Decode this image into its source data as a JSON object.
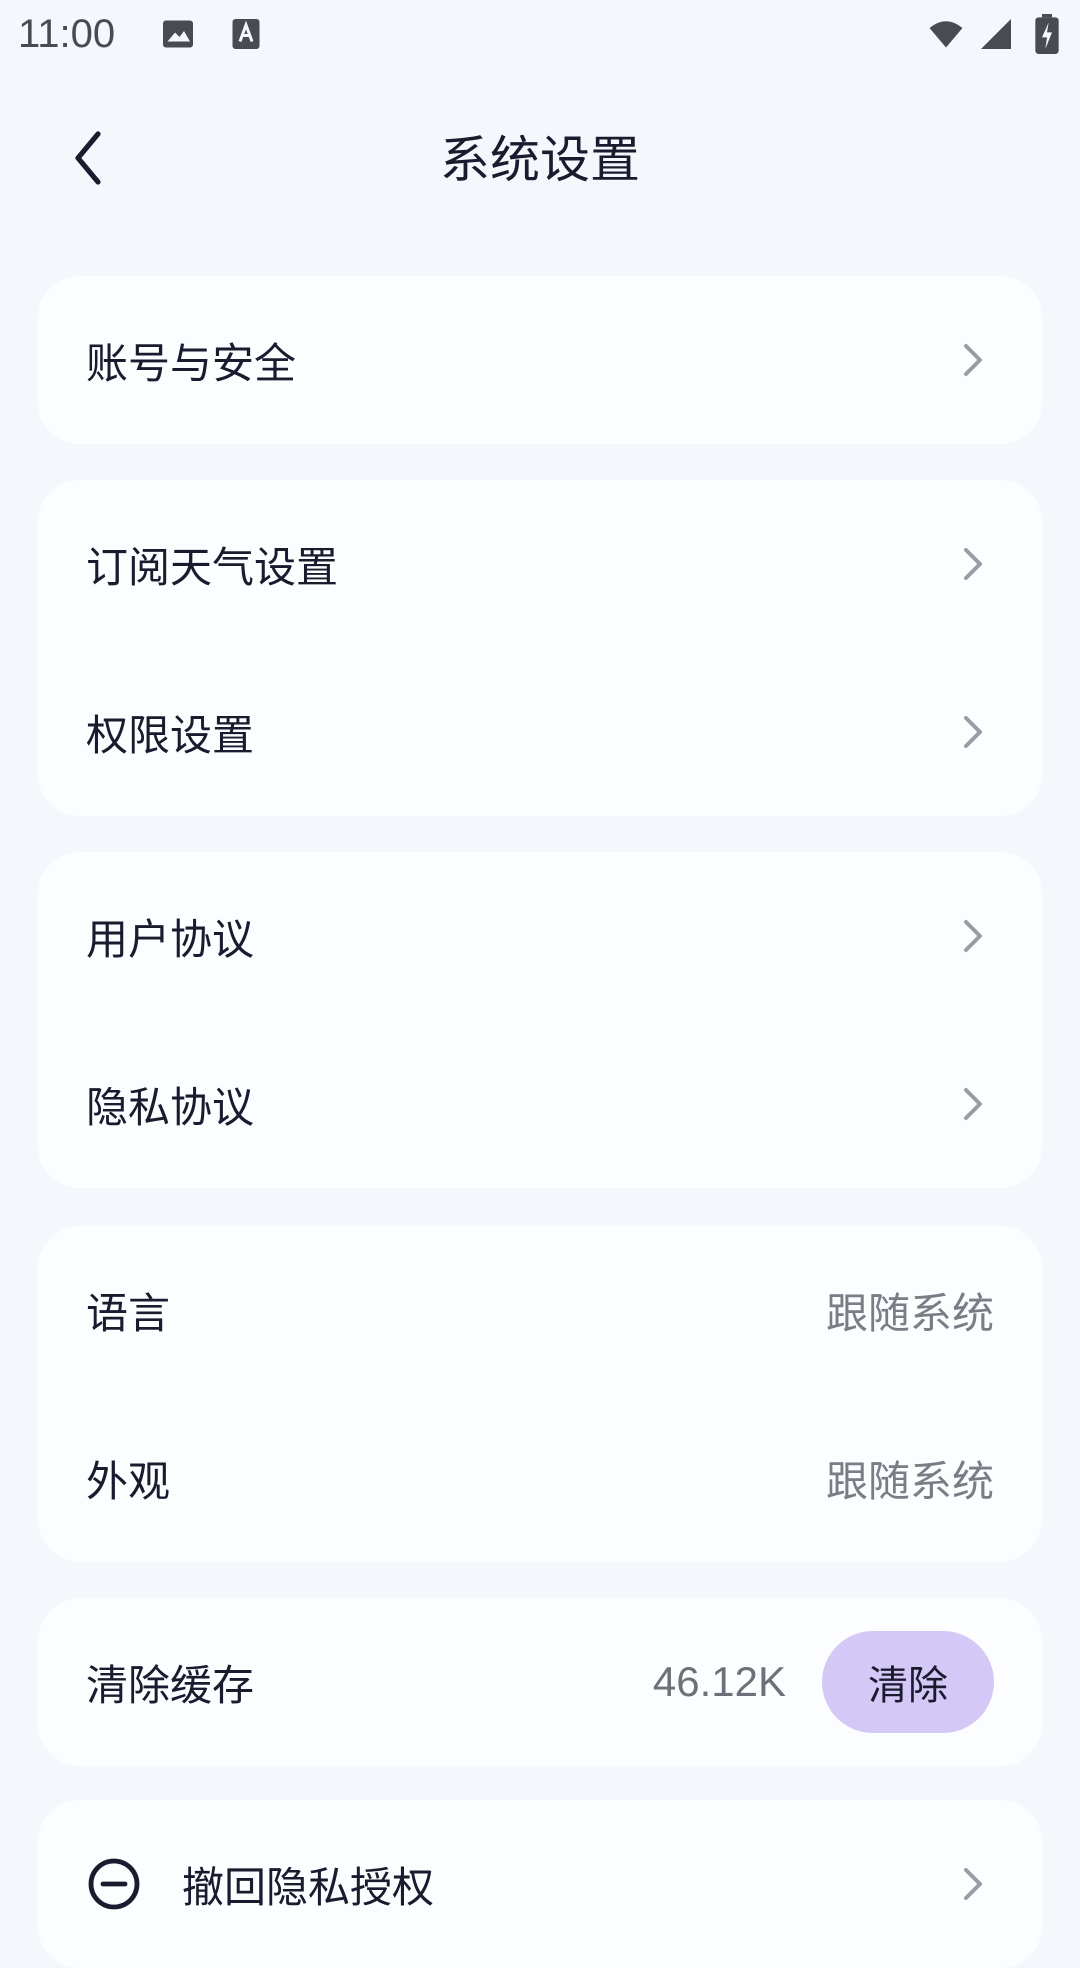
{
  "status_bar": {
    "time": "11:00",
    "icons": [
      "image-icon",
      "font-a-icon",
      "wifi-icon",
      "signal-icon",
      "battery-charging-icon"
    ]
  },
  "header": {
    "title": "系统设置",
    "back_icon": "chevron-left-icon"
  },
  "settings": {
    "account_security": "账号与安全",
    "weather_subscription": "订阅天气设置",
    "permissions": "权限设置",
    "user_agreement": "用户协议",
    "privacy_agreement": "隐私协议",
    "language": {
      "label": "语言",
      "value": "跟随系统"
    },
    "appearance": {
      "label": "外观",
      "value": "跟随系统"
    },
    "clear_cache": {
      "label": "清除缓存",
      "size": "46.12K",
      "button": "清除"
    },
    "revoke_privacy": {
      "label": "撤回隐私授权",
      "icon": "minus-circle-icon"
    }
  },
  "colors": {
    "background": "#f4f8fc",
    "card": "#fbfdff",
    "accent_button": "#d4c9f6",
    "text_primary": "#1b1b2f",
    "text_secondary": "#7a7c86"
  }
}
